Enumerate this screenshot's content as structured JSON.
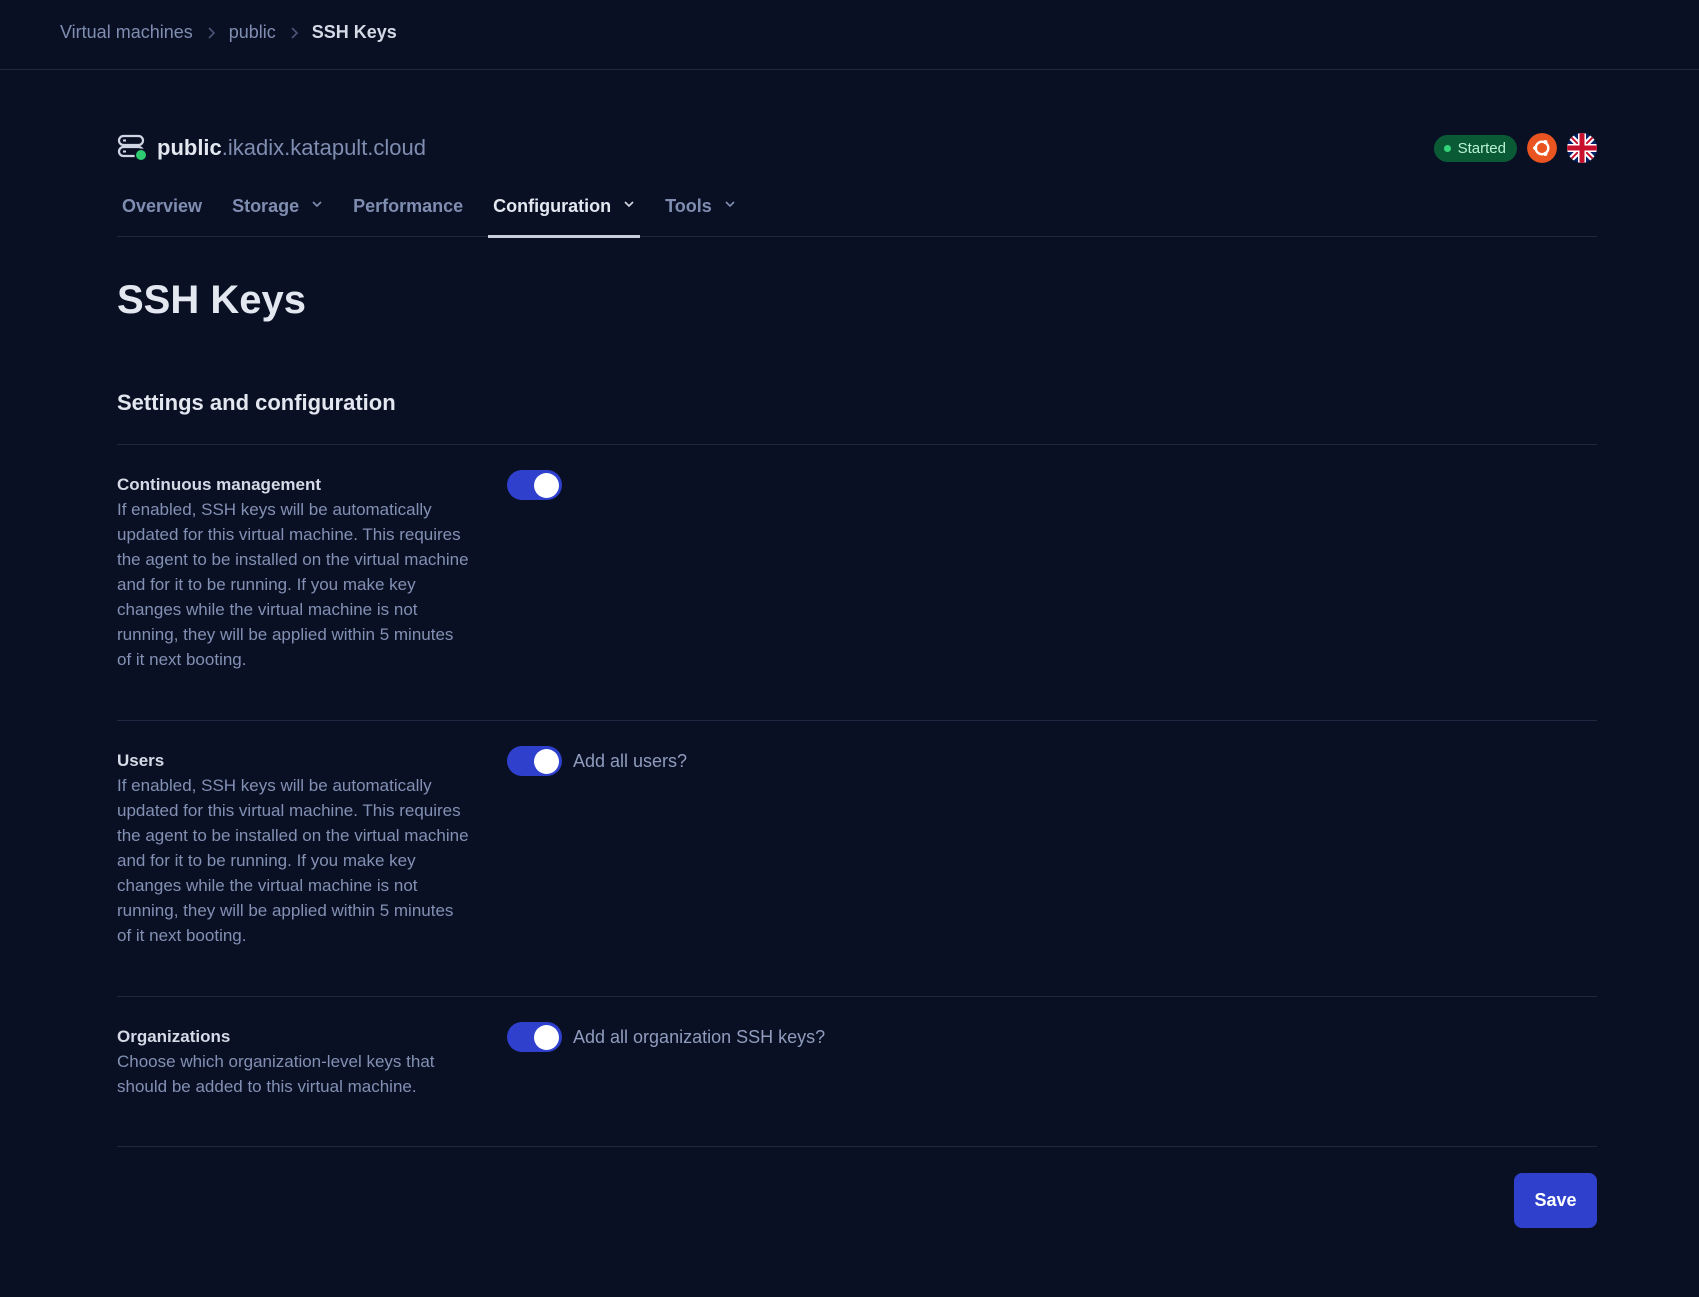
{
  "breadcrumb": [
    {
      "label": "Virtual machines"
    },
    {
      "label": "public"
    },
    {
      "label": "SSH Keys"
    }
  ],
  "vm": {
    "name": "public",
    "domain": ".ikadix.katapult.cloud",
    "status": "Started",
    "status_color": "#0b5a36",
    "os_icon": "ubuntu-icon",
    "region_flag": "uk-flag-icon"
  },
  "tabs": [
    {
      "label": "Overview",
      "has_dropdown": false
    },
    {
      "label": "Storage",
      "has_dropdown": true
    },
    {
      "label": "Performance",
      "has_dropdown": false
    },
    {
      "label": "Configuration",
      "has_dropdown": true,
      "active": true
    },
    {
      "label": "Tools",
      "has_dropdown": true
    }
  ],
  "page": {
    "title": "SSH Keys",
    "section_title": "Settings and configuration"
  },
  "settings": [
    {
      "label": "Continuous management",
      "description": "If enabled, SSH keys will be automatically updated for this virtual machine. This requires the agent to be installed on the virtual machine and for it to be running. If you make key changes while the virtual machine is not running, they will be applied within 5 minutes of it next booting.",
      "enabled": true,
      "toggle_label": ""
    },
    {
      "label": "Users",
      "description": "If enabled, SSH keys will be automatically updated for this virtual machine. This requires the agent to be installed on the virtual machine and for it to be running. If you make key changes while the virtual machine is not running, they will be applied within 5 minutes of it next booting.",
      "enabled": true,
      "toggle_label": "Add all users?"
    },
    {
      "label": "Organizations",
      "description": "Choose which organization-level keys that should be added to this virtual machine.",
      "enabled": true,
      "toggle_label": "Add all organization SSH keys?"
    }
  ],
  "actions": {
    "save_label": "Save"
  },
  "colors": {
    "accent": "#2e40cc",
    "background": "#0a1024",
    "status_dot": "#34d47a"
  }
}
